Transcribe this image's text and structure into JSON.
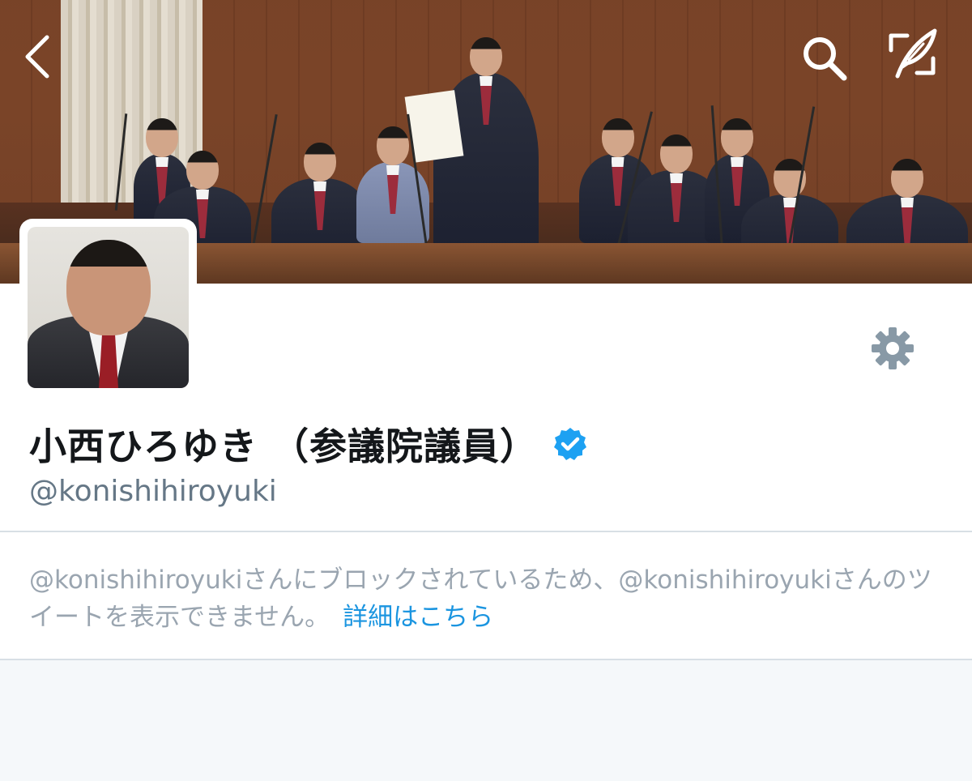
{
  "header": {
    "back_icon": "chevron-left-icon",
    "search_icon": "search-icon",
    "compose_icon": "compose-tweet-icon"
  },
  "profile": {
    "display_name": "小西ひろゆき （参議院議員）",
    "verified_icon": "verified-badge-icon",
    "handle": "@konishihiroyuki",
    "settings_icon": "gear-icon"
  },
  "notice": {
    "text": "@konishihiroyukiさんにブロックされているため、@konishihiroyukiさんのツイートを表示できません。",
    "link_label": "詳細はこちら"
  },
  "colors": {
    "link": "#1b95e0",
    "verified": "#1da1f2",
    "secondary_text": "#657786",
    "notice_text": "#9aa5b0",
    "background": "#f5f8fa"
  }
}
